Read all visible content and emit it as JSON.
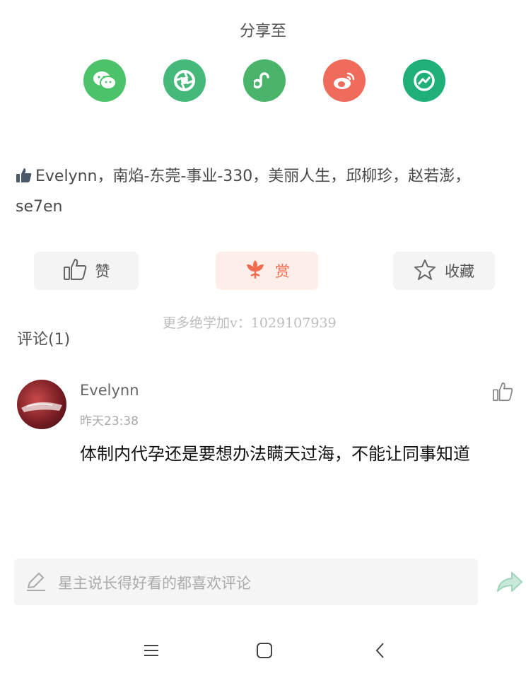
{
  "share": {
    "title": "分享至",
    "icons": [
      {
        "name": "wechat-icon",
        "color": "#4cc26a"
      },
      {
        "name": "moments-icon",
        "color": "#45b97a"
      },
      {
        "name": "mini-program-icon",
        "color": "#49b46a"
      },
      {
        "name": "weibo-icon",
        "color": "#ef6b5b"
      },
      {
        "name": "qzone-icon",
        "color": "#1fb07a"
      }
    ]
  },
  "likes": {
    "text": "Evelynn，南焰-东莞-事业-330，美丽人生，邱柳珍，赵若澎，se7en"
  },
  "actions": {
    "like_label": "赞",
    "reward_label": "赏",
    "favorite_label": "收藏"
  },
  "watermark": "更多绝学加v：1029107939",
  "comments": {
    "title": "评论(1)",
    "items": [
      {
        "author": "Evelynn",
        "time": "昨天23:38",
        "text": "体制内代孕还是要想办法瞒天过海，不能让同事知道"
      }
    ]
  },
  "input": {
    "placeholder": "星主说长得好看的都喜欢评论"
  },
  "colors": {
    "accent": "#f26b4f",
    "reward_bg": "#fdeee9",
    "button_bg": "#f4f4f4"
  }
}
